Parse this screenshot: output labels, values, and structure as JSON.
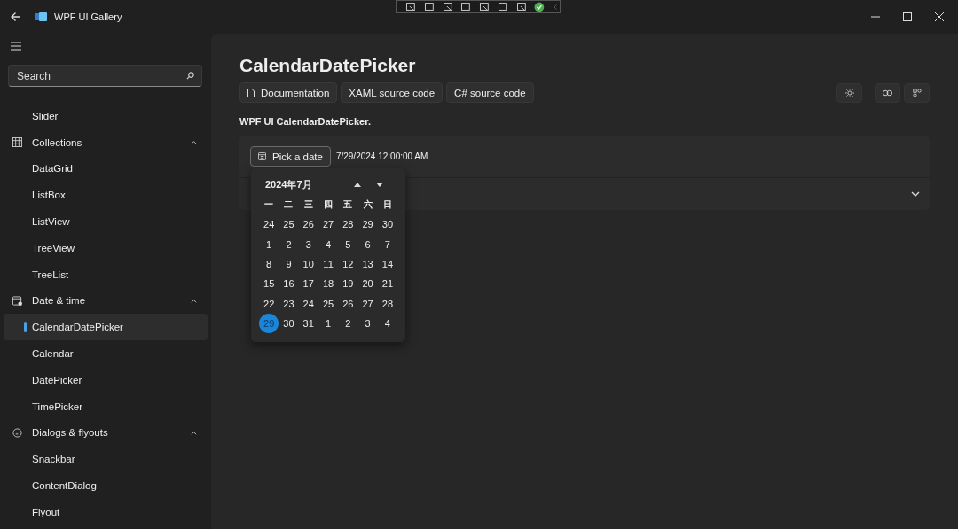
{
  "window": {
    "title": "WPF UI Gallery"
  },
  "sidebar": {
    "search": {
      "placeholder": "Search"
    },
    "items": [
      {
        "label": "Slider",
        "kind": "page",
        "selected": false
      },
      {
        "label": "Collections",
        "kind": "group",
        "expanded": true,
        "children": [
          {
            "label": "DataGrid",
            "selected": false
          },
          {
            "label": "ListBox",
            "selected": false
          },
          {
            "label": "ListView",
            "selected": false
          },
          {
            "label": "TreeView",
            "selected": false
          },
          {
            "label": "TreeList",
            "selected": false
          }
        ]
      },
      {
        "label": "Date & time",
        "kind": "group",
        "expanded": true,
        "children": [
          {
            "label": "CalendarDatePicker",
            "selected": true
          },
          {
            "label": "Calendar",
            "selected": false
          },
          {
            "label": "DatePicker",
            "selected": false
          },
          {
            "label": "TimePicker",
            "selected": false
          }
        ]
      },
      {
        "label": "Dialogs & flyouts",
        "kind": "group",
        "expanded": true,
        "children": [
          {
            "label": "Snackbar",
            "selected": false
          },
          {
            "label": "ContentDialog",
            "selected": false
          },
          {
            "label": "Flyout",
            "selected": false
          }
        ]
      }
    ]
  },
  "page": {
    "title": "CalendarDatePicker",
    "links": [
      {
        "label": "Documentation"
      },
      {
        "label": "XAML source code"
      },
      {
        "label": "C# source code"
      }
    ],
    "description": "WPF UI CalendarDatePicker.",
    "picker": {
      "button": "Pick a date",
      "value": "7/29/2024 12:00:00 AM"
    },
    "calendar": {
      "month": "2024年7月",
      "weekdays": [
        "一",
        "二",
        "三",
        "四",
        "五",
        "六",
        "日"
      ],
      "weeks": [
        [
          {
            "day": "24",
            "selected": false
          },
          {
            "day": "25",
            "selected": false
          },
          {
            "day": "26",
            "selected": false
          },
          {
            "day": "27",
            "selected": false
          },
          {
            "day": "28",
            "selected": false
          },
          {
            "day": "29",
            "selected": false
          },
          {
            "day": "30",
            "selected": false
          }
        ],
        [
          {
            "day": "1",
            "selected": false
          },
          {
            "day": "2",
            "selected": false
          },
          {
            "day": "3",
            "selected": false
          },
          {
            "day": "4",
            "selected": false
          },
          {
            "day": "5",
            "selected": false
          },
          {
            "day": "6",
            "selected": false
          },
          {
            "day": "7",
            "selected": false
          }
        ],
        [
          {
            "day": "8",
            "selected": false
          },
          {
            "day": "9",
            "selected": false
          },
          {
            "day": "10",
            "selected": false
          },
          {
            "day": "11",
            "selected": false
          },
          {
            "day": "12",
            "selected": false
          },
          {
            "day": "13",
            "selected": false
          },
          {
            "day": "14",
            "selected": false
          }
        ],
        [
          {
            "day": "15",
            "selected": false
          },
          {
            "day": "16",
            "selected": false
          },
          {
            "day": "17",
            "selected": false
          },
          {
            "day": "18",
            "selected": false
          },
          {
            "day": "19",
            "selected": false
          },
          {
            "day": "20",
            "selected": false
          },
          {
            "day": "21",
            "selected": false
          }
        ],
        [
          {
            "day": "22",
            "selected": false
          },
          {
            "day": "23",
            "selected": false
          },
          {
            "day": "24",
            "selected": false
          },
          {
            "day": "25",
            "selected": false
          },
          {
            "day": "26",
            "selected": false
          },
          {
            "day": "27",
            "selected": false
          },
          {
            "day": "28",
            "selected": false
          }
        ],
        [
          {
            "day": "29",
            "selected": true
          },
          {
            "day": "30",
            "selected": false
          },
          {
            "day": "31",
            "selected": false
          },
          {
            "day": "1",
            "selected": false
          },
          {
            "day": "2",
            "selected": false
          },
          {
            "day": "3",
            "selected": false
          },
          {
            "day": "4",
            "selected": false
          }
        ]
      ]
    }
  }
}
